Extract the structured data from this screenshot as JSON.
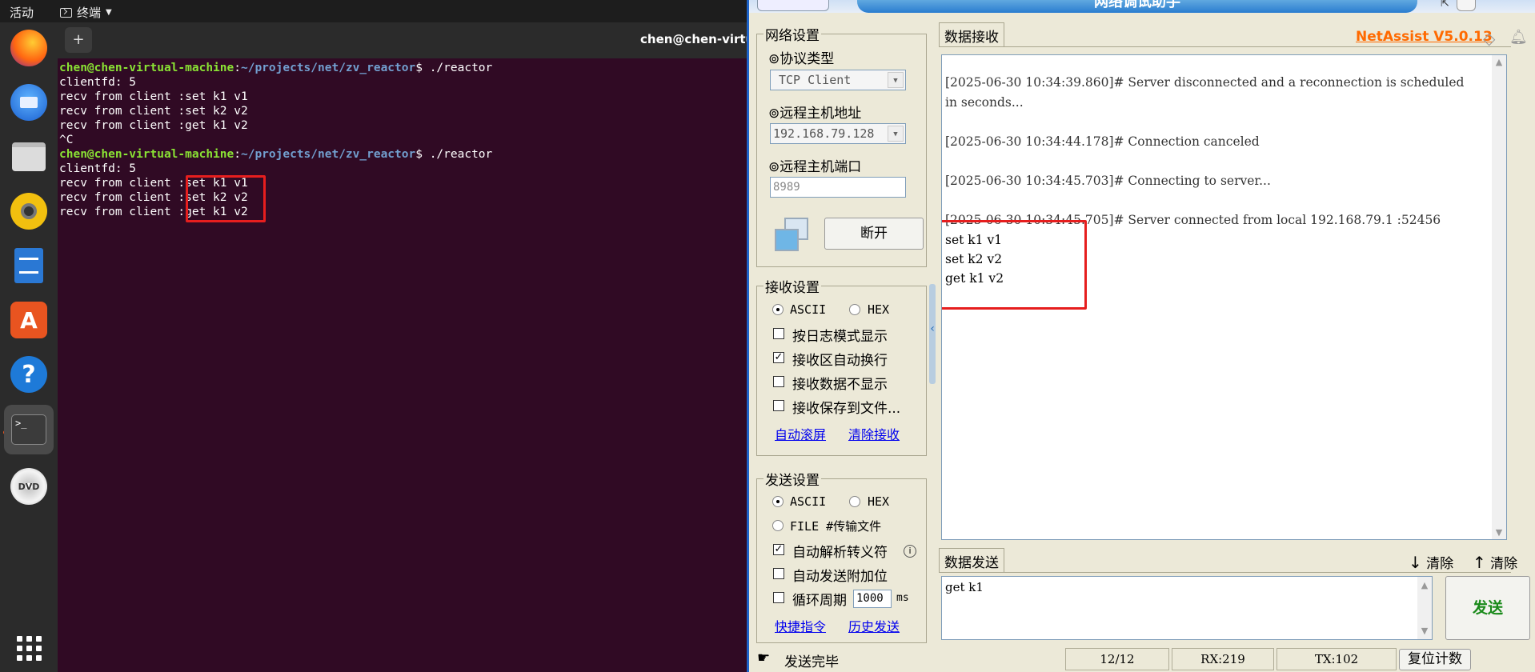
{
  "topbar": {
    "activities": "活动",
    "app_menu": "终端"
  },
  "dock": {
    "items": [
      {
        "name": "firefox"
      },
      {
        "name": "thunderbird"
      },
      {
        "name": "files"
      },
      {
        "name": "rhythmbox"
      },
      {
        "name": "libreoffice-writer"
      },
      {
        "name": "app-center"
      },
      {
        "name": "help",
        "glyph": "?"
      },
      {
        "name": "terminal",
        "glyph": ">_",
        "active": true
      },
      {
        "name": "dvd",
        "glyph": "DVD"
      },
      {
        "name": "show-apps"
      }
    ]
  },
  "terminal": {
    "title": "chen@chen-virtual-machine: ~/projects/net/zv_reactor",
    "new_tab_label": "+",
    "prompt_user": "chen@chen-virtual-machine",
    "prompt_path": "~/projects/net/zv_reactor",
    "command": " ./reactor",
    "lines_a": [
      "clientfd: 5",
      "recv from client :set k1 v1",
      "recv from client :set k2 v2",
      "recv from client :get k1 v2",
      "^C"
    ],
    "lines_b": [
      "clientfd: 5",
      "recv from client :set k1 v1",
      "recv from client :set k2 v2",
      "recv from client :get k1 v2"
    ]
  },
  "netassist": {
    "brand": "NetAssist V5.0.13",
    "title": "网络调试助手",
    "net_settings": {
      "legend": "网络设置",
      "protocol_label": "⊚协议类型",
      "protocol_value": "TCP Client",
      "remote_host_label": "⊚远程主机地址",
      "remote_host_value": "192.168.79.128",
      "remote_port_label": "⊚远程主机端口",
      "remote_port_value": "8989",
      "disconnect_button": "断开"
    },
    "recv_settings": {
      "legend": "接收设置",
      "ascii": "ASCII",
      "hex": "HEX",
      "log_mode": "按日志模式显示",
      "auto_wrap": "接收区自动换行",
      "hide_data": "接收数据不显示",
      "save_file": "接收保存到文件...",
      "auto_scroll": "自动滚屏",
      "clear_recv": "清除接收"
    },
    "send_settings": {
      "legend": "发送设置",
      "ascii": "ASCII",
      "hex": "HEX",
      "file": "FILE #传输文件",
      "escape": "自动解析转义符",
      "append": "自动发送附加位",
      "loop": "循环周期",
      "period": "1000",
      "unit": "ms",
      "shortcuts": "快捷指令",
      "history": "历史发送"
    },
    "recv_tab": "数据接收",
    "recv_lines": [
      "[2025-06-30 10:34:39.860]# Server disconnected and a reconnection is scheduled",
      "in seconds...",
      "[2025-06-30 10:34:44.178]# Connection canceled",
      "[2025-06-30 10:34:45.703]# Connecting to server...",
      "[2025-06-30 10:34:45.705]# Server connected from local 192.168.79.1 :52456",
      "set k1 v1",
      "set k2 v2",
      "get k1 v2"
    ],
    "send_tab": "数据发送",
    "clear1": "清除",
    "clear2": "清除",
    "send_text": "get k1",
    "send_button": "发送",
    "status": {
      "msg": "发送完毕",
      "count": "12/12",
      "rx": "RX:219",
      "tx": "TX:102",
      "reset": "复位计数"
    }
  }
}
